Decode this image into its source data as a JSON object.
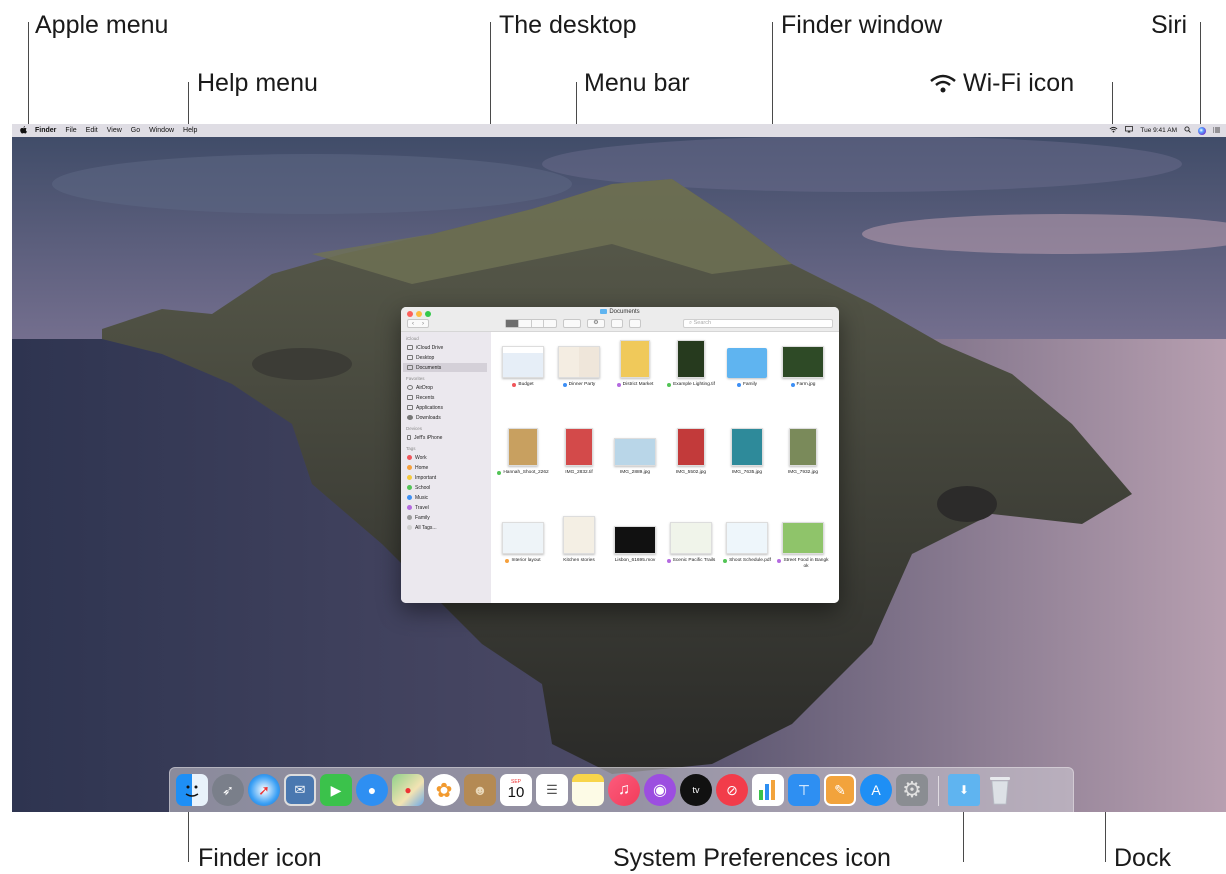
{
  "callouts": {
    "apple_menu": "Apple menu",
    "help_menu": "Help menu",
    "desktop": "The desktop",
    "menu_bar": "Menu bar",
    "finder_window": "Finder window",
    "wifi": "Wi-Fi icon",
    "siri": "Siri",
    "finder_icon": "Finder icon",
    "system_prefs": "System Preferences icon",
    "dock": "Dock"
  },
  "menubar": {
    "apple": "",
    "items": [
      "Finder",
      "File",
      "Edit",
      "View",
      "Go",
      "Window",
      "Help"
    ],
    "clock": "Tue 9:41 AM"
  },
  "finder": {
    "title": "Documents",
    "search_placeholder": "Search",
    "sidebar": {
      "icloud_header": "iCloud",
      "icloud": [
        "iCloud Drive",
        "Desktop",
        "Documents"
      ],
      "favorites_header": "Favorites",
      "favorites": [
        "AirDrop",
        "Recents",
        "Applications",
        "Downloads"
      ],
      "devices_header": "Devices",
      "devices": [
        "Jeff's iPhone"
      ],
      "tags_header": "Tags",
      "tags": [
        {
          "label": "Work",
          "color": "#f0555a"
        },
        {
          "label": "Home",
          "color": "#f5a03c"
        },
        {
          "label": "Important",
          "color": "#f5c93c"
        },
        {
          "label": "School",
          "color": "#52c455"
        },
        {
          "label": "Music",
          "color": "#3d8ff5"
        },
        {
          "label": "Travel",
          "color": "#b46ae0"
        },
        {
          "label": "Family",
          "color": "#9a9a9a"
        },
        {
          "label": "All Tags...",
          "color": "#d0d0d0"
        }
      ]
    },
    "files": [
      {
        "name": "Budget",
        "tag": "#f0555a"
      },
      {
        "name": "Dinner Party",
        "tag": "#3d8ff5"
      },
      {
        "name": "District Market",
        "tag": "#b46ae0"
      },
      {
        "name": "Example Lighting.tif",
        "tag": "#52c455"
      },
      {
        "name": "Family",
        "tag": "#3d8ff5"
      },
      {
        "name": "Farm.jpg",
        "tag": "#3d8ff5"
      },
      {
        "name": "Hannah_Shoot_2262",
        "tag": "#52c455"
      },
      {
        "name": "IMG_2832.tif",
        "tag": ""
      },
      {
        "name": "IMG_2889.jpg",
        "tag": ""
      },
      {
        "name": "IMG_5502.jpg",
        "tag": ""
      },
      {
        "name": "IMG_7635.jpg",
        "tag": ""
      },
      {
        "name": "IMG_7932.jpg",
        "tag": ""
      },
      {
        "name": "Interior layout",
        "tag": "#f5a03c"
      },
      {
        "name": "Kitchen stories",
        "tag": ""
      },
      {
        "name": "Lisbon_61695.mov",
        "tag": ""
      },
      {
        "name": "Scenic Pacific Trails",
        "tag": "#b46ae0"
      },
      {
        "name": "Shoot Schedule.pdf",
        "tag": "#52c455"
      },
      {
        "name": "Street Food in Bangkok",
        "tag": "#b46ae0"
      }
    ]
  },
  "dock": {
    "calendar_day": "10",
    "calendar_month": "SEP",
    "tv_label": "tv"
  }
}
